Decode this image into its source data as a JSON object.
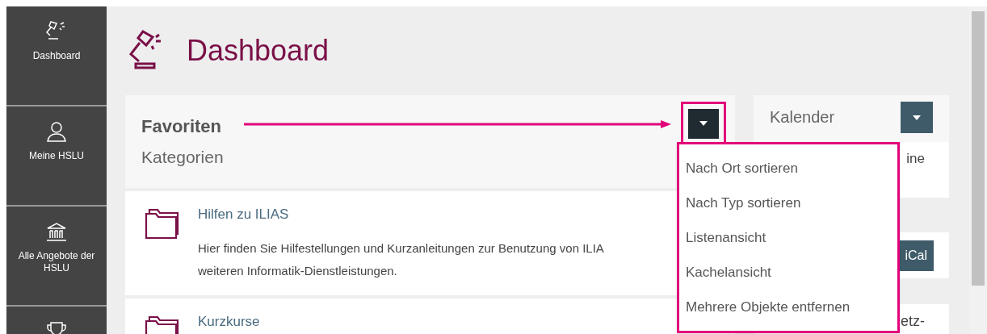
{
  "sidebar": {
    "items": [
      {
        "label": "Dashboard",
        "kind": "lamp"
      },
      {
        "label": "Meine HSLU",
        "kind": "person"
      },
      {
        "label": "Alle Angebote der HSLU",
        "kind": "building"
      },
      {
        "kind": "trophy"
      }
    ]
  },
  "page": {
    "title": "Dashboard"
  },
  "favorites": {
    "title": "Favoriten",
    "section": "Kategorien",
    "items": [
      {
        "title": "Hilfen zu ILIAS",
        "description": [
          "Hier finden Sie Hilfestellungen und Kurzanleitungen zur Benutzung von ILIA",
          "weiteren Informatik-Dienstleistungen."
        ]
      },
      {
        "title": "Kurzkurse"
      }
    ]
  },
  "menu": {
    "items": [
      "Nach Ort sortieren",
      "Nach Typ sortieren",
      "Listenansicht",
      "Kachelansicht",
      "Mehrere Objekte entfernen"
    ]
  },
  "calendar": {
    "title": "Kalender",
    "text": "ine"
  },
  "ical": {
    "button": "iCal"
  },
  "panel_3": {
    "text": "etz-"
  }
}
